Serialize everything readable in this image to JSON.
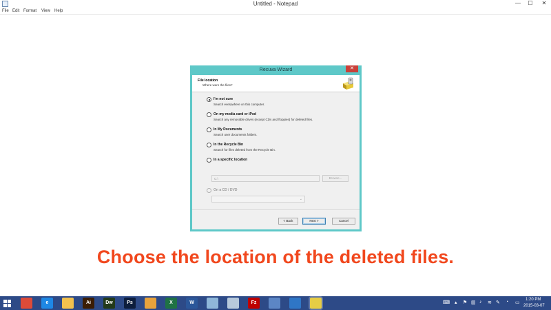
{
  "window": {
    "title": "Untitled - Notepad",
    "minimize": "—",
    "maximize": "☐",
    "close": "✕"
  },
  "menu": {
    "items": [
      "File",
      "Edit",
      "Format",
      "View",
      "Help"
    ]
  },
  "dialog": {
    "title": "Recuva Wizard",
    "close": "✕",
    "header_title": "File location",
    "header_subtitle": "Where were the files?",
    "options": [
      {
        "label": "I'm not sure",
        "desc": "Search everywhere on this computer.",
        "checked": true
      },
      {
        "label": "On my media card or iPod",
        "desc": "Search any removable drives (except CDs and floppies) for deleted files.",
        "checked": false
      },
      {
        "label": "In My Documents",
        "desc": "Search user documents folders.",
        "checked": false
      },
      {
        "label": "In the Recycle Bin",
        "desc": "Search for files deleted from the Recycle Bin.",
        "checked": false
      },
      {
        "label": "In a specific location",
        "desc": "",
        "checked": false
      },
      {
        "label": "On a CD / DVD",
        "desc": "",
        "checked": false,
        "disabled": true
      }
    ],
    "location_value": "C:\\",
    "browse_label": "Browse...",
    "back_label": "< Back",
    "next_label": "Next >",
    "cancel_label": "Cancel"
  },
  "caption": "Choose the location of the deleted files.",
  "taskbar": {
    "apps": [
      {
        "name": "chrome",
        "label": "",
        "bg": "#dd4b39"
      },
      {
        "name": "internet-explorer",
        "label": "e",
        "bg": "#1e88e5"
      },
      {
        "name": "file-explorer",
        "label": "",
        "bg": "#f2c14e"
      },
      {
        "name": "illustrator",
        "label": "Ai",
        "bg": "#3b1d05"
      },
      {
        "name": "dreamweaver",
        "label": "Dw",
        "bg": "#233a1a"
      },
      {
        "name": "photoshop",
        "label": "Ps",
        "bg": "#0d1e3d"
      },
      {
        "name": "outlook",
        "label": "",
        "bg": "#e8a33c"
      },
      {
        "name": "excel",
        "label": "X",
        "bg": "#1f7244"
      },
      {
        "name": "word",
        "label": "W",
        "bg": "#2b579a"
      },
      {
        "name": "notepad-app",
        "label": "",
        "bg": "#8fb7d9"
      },
      {
        "name": "notepad-alt",
        "label": "",
        "bg": "#b7c9db"
      },
      {
        "name": "filezilla",
        "label": "Fz",
        "bg": "#bf0000"
      },
      {
        "name": "network",
        "label": "",
        "bg": "#5c86c5"
      },
      {
        "name": "teamviewer",
        "label": "",
        "bg": "#2f76c6"
      },
      {
        "name": "recuva",
        "label": "",
        "bg": "#e6cd45"
      }
    ],
    "time": "1:20 PM",
    "date": "2015-03-07"
  }
}
